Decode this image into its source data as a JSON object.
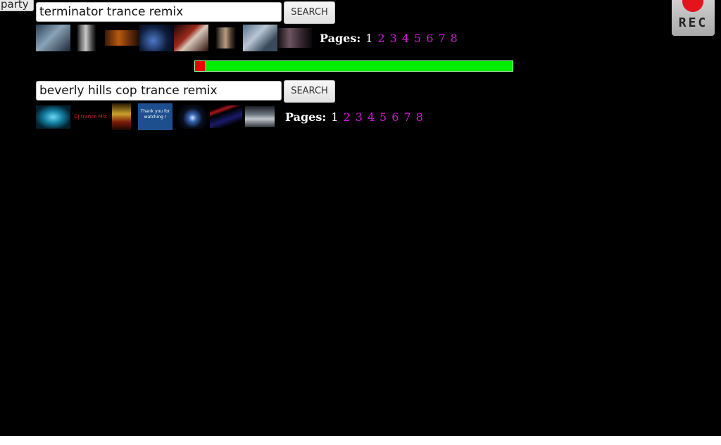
{
  "party_button": {
    "label": "party"
  },
  "rec_button": {
    "label": "REC"
  },
  "rows": [
    {
      "query": "terminator trance remix",
      "search_label": "SEARCH",
      "pages_label": "Pages:",
      "current_page": "1",
      "other_pages": [
        "2",
        "3",
        "4",
        "5",
        "6",
        "7",
        "8"
      ]
    },
    {
      "query": "beverly hills cop trance remix",
      "search_label": "SEARCH",
      "pages_label": "Pages:",
      "current_page": "1",
      "other_pages": [
        "2",
        "3",
        "4",
        "5",
        "6",
        "7",
        "8"
      ]
    }
  ],
  "progress": {
    "fraction": 0.03
  },
  "thumbnail_text": {
    "row2_thumb2": "DJ trance Mix",
    "row2_thumb4": "Thank you for watching !"
  },
  "colors": {
    "background": "#000000",
    "page_link": "#d11ad6",
    "progress_track": "#00ef00",
    "progress_fill": "#ef0000",
    "rec_dot": "#e3141c"
  }
}
